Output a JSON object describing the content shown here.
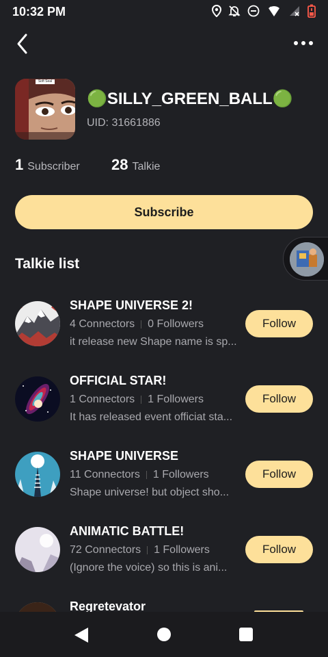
{
  "status_bar": {
    "time": "10:32 PM",
    "icons": [
      "location-icon",
      "notifications-off-icon",
      "do-not-disturb-icon",
      "wifi-icon",
      "cellular-no-signal-icon",
      "battery-low-icon"
    ]
  },
  "top_bar": {
    "back_icon": "chevron-left-icon",
    "more_icon": "more-horizontal-icon"
  },
  "profile": {
    "avatar_badge": "Soft Seal",
    "name": "🟢SILLY_GREEN_BALL🟢",
    "uid": "UID: 31661886",
    "subscribers_count": "1",
    "subscribers_label": "Subscriber",
    "talkie_count": "28",
    "talkie_label": "Talkie"
  },
  "subscribe_button": "Subscribe",
  "section_title": "Talkie list",
  "talkies": [
    {
      "title": "SHAPE UNIVERSE 2!",
      "connectors": "4 Connectors",
      "followers": "0 Followers",
      "description": "it release new Shape name is sp...",
      "follow_label": "Follow"
    },
    {
      "title": "OFFICIAL STAR!",
      "connectors": "1 Connectors",
      "followers": "1 Followers",
      "description": "It has released event officiat sta...",
      "follow_label": "Follow"
    },
    {
      "title": "SHAPE UNIVERSE",
      "connectors": "11 Connectors",
      "followers": "1 Followers",
      "description": "Shape universe! but object sho...",
      "follow_label": "Follow"
    },
    {
      "title": "ANIMATIC BATTLE!",
      "connectors": "72 Connectors",
      "followers": "1 Followers",
      "description": "(Ignore the voice) so this is ani...",
      "follow_label": "Follow"
    },
    {
      "title": "Regretevator"
    }
  ],
  "nav_bar": {
    "icons": [
      "nav-back-icon",
      "nav-home-icon",
      "nav-recents-icon"
    ]
  },
  "colors": {
    "background": "#1f2024",
    "accent": "#fde09a",
    "muted_text": "#a9a9ae"
  }
}
